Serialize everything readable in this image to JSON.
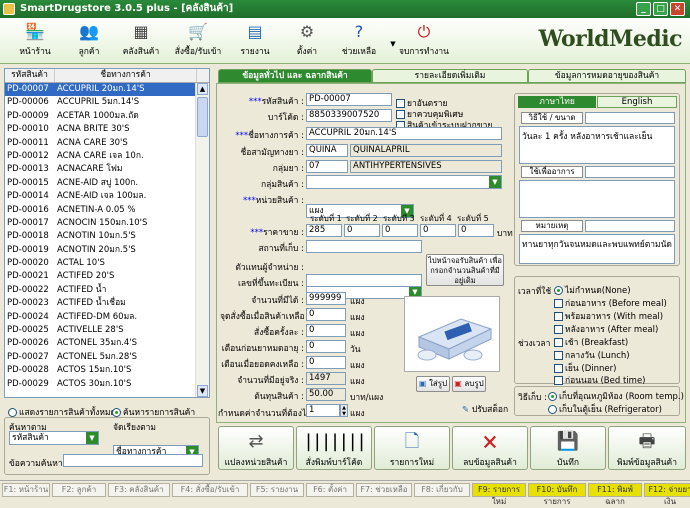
{
  "window": {
    "title": "SmartDrugstore 3.0.5 plus - [คลังสินค้า]",
    "brand": "WorldMedic"
  },
  "toolbar": [
    {
      "label": "หน้าร้าน",
      "icon": "storefront-icon"
    },
    {
      "label": "ลูกค้า",
      "icon": "customer-icon"
    },
    {
      "label": "คลังสินค้า",
      "icon": "warehouse-icon"
    },
    {
      "label": "สั่งซื้อ/รับเข้า",
      "icon": "purchase-icon"
    },
    {
      "label": "รายงาน",
      "icon": "report-icon"
    },
    {
      "label": "ตั้งค่า",
      "icon": "settings-icon"
    },
    {
      "label": "ช่วยเหลือ",
      "icon": "help-icon"
    },
    {
      "label": "จบการทำงาน",
      "icon": "exit-icon"
    }
  ],
  "list": {
    "headers": [
      "รหัสสินค้า",
      "ชื่อทางการค้า"
    ],
    "rows": [
      [
        "PD-00007",
        "ACCUPRIL 20มก.14'S"
      ],
      [
        "PD-00006",
        "ACCUPRIL 5มก.14'S"
      ],
      [
        "PD-00009",
        "ACETAR 1000มล.ถัด"
      ],
      [
        "PD-00010",
        "ACNA BRITE 30'S"
      ],
      [
        "PD-00011",
        "ACNA CARE 30'S"
      ],
      [
        "PD-00012",
        "ACNA CARE เจล 10ก."
      ],
      [
        "PD-00013",
        "ACNACARE โฟม"
      ],
      [
        "PD-00015",
        "ACNE-AID สบู่ 100ก."
      ],
      [
        "PD-00014",
        "ACNE-AID เจล 100มล."
      ],
      [
        "PD-00016",
        "ACNETIN-A 0.05 %"
      ],
      [
        "PD-00017",
        "ACNOCIN 150มก.10'S"
      ],
      [
        "PD-00018",
        "ACNOTIN 10มก.5'S"
      ],
      [
        "PD-00019",
        "ACNOTIN 20มก.5'S"
      ],
      [
        "PD-00020",
        "ACTAL 10'S"
      ],
      [
        "PD-00021",
        "ACTIFED 20'S"
      ],
      [
        "PD-00022",
        "ACTIFED น้ำ"
      ],
      [
        "PD-00023",
        "ACTIFED น้ำเชื่อม"
      ],
      [
        "PD-00024",
        "ACTIFED-DM 60มล."
      ],
      [
        "PD-00025",
        "ACTIVELLE 28'S"
      ],
      [
        "PD-00026",
        "ACTONEL 35มก.4'S"
      ],
      [
        "PD-00027",
        "ACTONEL 5มก.28'S"
      ],
      [
        "PD-00028",
        "ACTOS 15มก.10'S"
      ],
      [
        "PD-00029",
        "ACTOS 30มก.10'S"
      ]
    ],
    "selected_index": 0
  },
  "filters": {
    "show_all": "แสดงรายการสินค้าทั้งหมด",
    "search_products": "ค้นหารายการสินค้า",
    "search_by_label": "ค้นหาตาม",
    "search_by_value": "รหัสสินค้า",
    "sort_label": "จัดเรียงตาม",
    "sort_value": "ชื่อทางการค้า",
    "keyword_label": "ข้อความค้นหา"
  },
  "tabs": [
    "ข้อมูลทั่วไป และ ฉลากสินค้า",
    "รายละเอียดเพิ่มเติม",
    "ข้อมูลการหมดอายุของสินค้า"
  ],
  "form": {
    "code_label": "รหัสสินค้า :",
    "code": "PD-00007",
    "barcode_label": "บาร์โค้ด :",
    "barcode": "8850339007520",
    "trade_label": "ชื่อทางการค้า :",
    "trade": "ACCUPRIL 20มก.14'S",
    "generic_label": "ชื่อสามัญทางยา :",
    "generic1": "QUINA",
    "generic2": "QUINALAPRIL",
    "group_label": "กลุ่มยา :",
    "group_code": "07",
    "group_name": "ANTIHYPERTENSIVES",
    "category_label": "กลุ่มสินค้า :",
    "category": "",
    "unit_label": "หน่วยสินค้า :",
    "unit": "แผง",
    "cb_dangerous": "ยาอันตราย",
    "cb_controlled": "ยาควบคุมพิเศษ",
    "cb_consign": "สินค้าเข้าระบบฝากขาย",
    "price_levels": [
      "ระดับที่ 1",
      "ระดับที่ 2",
      "ระดับที่ 3",
      "ระดับที่ 4",
      "ระดับที่ 5"
    ],
    "price_label": "ราคาขาย :",
    "prices": [
      "285",
      "0",
      "0",
      "0",
      "0"
    ],
    "price_unit": "บาท",
    "location_label": "สถานที่เก็บ :",
    "supplier_label": "ตัวแทนผู้จำหน่าย :",
    "supplier_btn": "ไปหน้าจอรับสินค้า เพื่อกรอกจำนวนสินค้าที่มีอยู่เดิม",
    "reg_label": "เลขที่ขึ้นทะเบียน :",
    "qty_label": "จำนวนที่มีได้ :",
    "qty": "999999",
    "qty_unit": "แผง",
    "reorder_label": "จุดสั่งซื้อเมื่อสินค้าเหลือ :",
    "reorder": "0",
    "reorder_unit": "แผง",
    "orderqty_label": "สั่งซื้อครั้งละ :",
    "orderqty": "0",
    "orderqty_unit": "แผง",
    "expwarn_label": "เตือนก่อนยาหมดอายุ :",
    "expwarn": "0",
    "expwarn_unit": "วัน",
    "lowwarn_label": "เตือนเมื่อยอดคงเหลือ :",
    "lowwarn": "0",
    "lowwarn_unit": "แผง",
    "stock_label": "จำนวนที่มีอยู่จริง :",
    "stock": "1497",
    "stock_unit": "แผง",
    "cost_label": "ต้นทุนสินค้า :",
    "cost": "50.00",
    "cost_unit": "บาท/แผง",
    "spin_label": "กำหนดค่าจำนวนที่ต้องไม่ให้คือ :",
    "spin": "1",
    "spin_unit": "แผง",
    "img_add": "ใส่รูป",
    "img_del": "ลบรูป",
    "adjust": "ปรับสต็อก"
  },
  "label": {
    "tab_th": "ภาษาไทย",
    "tab_en": "English",
    "dose_label": "วิธีใช้ / ขนาด",
    "dose_text": "วันละ 1 ครั้ง หลังอาหารเช้าและเย็น",
    "indication_label": "ใช้เพื่ออาการ",
    "indication_text": "",
    "note_label": "หมายเหตุ",
    "note_text": "ทานยาทุกวันจนหมดและพบแพทย์ตามนัด",
    "time_label": "เวลาที่ใช้ :",
    "times": [
      "ไม่กำหนด(None)",
      "ก่อนอาหาร (Before meal)",
      "พร้อมอาหาร (With meal)",
      "หลังอาหาร (After meal)"
    ],
    "period_label": "ช่วงเวลา :",
    "periods": [
      "เช้า (Breakfast)",
      "กลางวัน (Lunch)",
      "เย็น (Dinner)",
      "ก่อนนอน (Bed time)"
    ],
    "storage_label": "วิธีเก็บ :",
    "storage": [
      "เก็บที่อุณหภูมิห้อง (Room temp.)",
      "เก็บในตู้เย็น (Refrigerator)"
    ]
  },
  "actions": [
    "แปลงหน่วยสินค้า",
    "สั่งพิมพ์บาร์โค้ด",
    "รายการใหม่",
    "ลบข้อมูลสินค้า",
    "บันทึก",
    "พิมพ์ข้อมูลสินค้า"
  ],
  "status": [
    "F1: หน้าร้าน",
    "F2: ลูกค้า",
    "F3: คลังสินค้า",
    "F4: สั่งซื้อ/รับเข้า",
    "F5: รายงาน",
    "F6: ตั้งค่า",
    "F7: ช่วยเหลือ",
    "F8: เกี่ยวกับ",
    "F9: รายการใหม่",
    "F10: บันทึกรายการ",
    "F11: พิมพ์ฉลาก",
    "F12: จ่ายยาเงิน"
  ],
  "colors": {
    "accent": "#2e8a2e",
    "selection": "#316ac5",
    "fkey_highlight": "#e7e100"
  }
}
